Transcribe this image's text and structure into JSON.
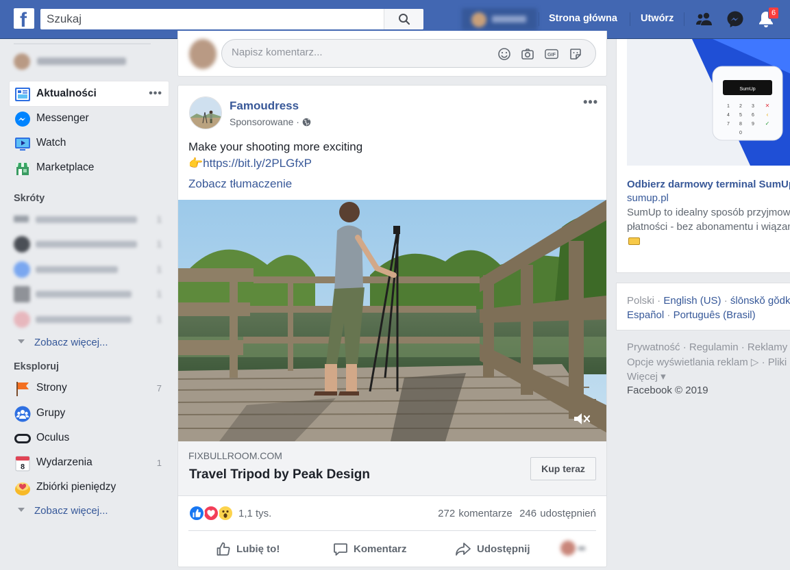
{
  "topbar": {
    "search_placeholder": "Szukaj",
    "profile_name": "Marek",
    "nav_home": "Strona główna",
    "nav_create": "Utwórz",
    "notifications_count": "6"
  },
  "sidebar": {
    "profile_name": "Marek Dombrowski",
    "main_items": [
      {
        "label": "Aktualności",
        "icon": "news-feed-icon",
        "more": "•••"
      },
      {
        "label": "Messenger",
        "icon": "messenger-icon"
      },
      {
        "label": "Watch",
        "icon": "watch-icon"
      },
      {
        "label": "Marketplace",
        "icon": "marketplace-icon"
      }
    ],
    "shortcuts_title": "Skróty",
    "shortcuts": [
      {
        "label": "Peak Design Polska",
        "count": "1"
      },
      {
        "label": "Il Leggero Thing Pro",
        "count": "1"
      },
      {
        "label": "Peak Design Vest",
        "count": "1"
      },
      {
        "label": "FUJIKAMARA - E",
        "count": "1"
      },
      {
        "label": "Interiorcanl Djales",
        "count": "1"
      }
    ],
    "see_more_1": "Zobacz więcej...",
    "explore_title": "Eksploruj",
    "explore": [
      {
        "label": "Strony",
        "icon": "flag-icon",
        "count": "7"
      },
      {
        "label": "Grupy",
        "icon": "groups-icon",
        "count": ""
      },
      {
        "label": "Oculus",
        "icon": "oculus-icon",
        "count": ""
      },
      {
        "label": "Wydarzenia",
        "icon": "calendar-icon",
        "count": "1",
        "calendar_day": "8"
      },
      {
        "label": "Zbiórki pieniędzy",
        "icon": "fundraiser-icon",
        "count": ""
      }
    ],
    "see_more_2": "Zobacz więcej..."
  },
  "comment": {
    "placeholder": "Napisz komentarz..."
  },
  "post": {
    "author": "Famoudress",
    "meta": "Sponsorowane · ",
    "text": "Make your shooting more exciting",
    "link_emoji": "👉",
    "link": "https://bit.ly/2PLGfxP",
    "translate": "Zobacz tłumaczenie",
    "link_domain": "FIXBULLROOM.COM",
    "link_title": "Travel Tripod by Peak Design",
    "cta": "Kup teraz",
    "reactions_count": "1,1 tys.",
    "comments": "272 komentarze",
    "shares": "246 udostępnień",
    "like_label": "Lubię to!",
    "comment_label": "Komentarz",
    "share_label": "Udostępnij"
  },
  "ad": {
    "title": "Odbierz darmowy terminal SumUp",
    "domain": "sumup.pl",
    "desc_line1": "SumUp to idealny sposób przyjmowania",
    "desc_line2": "płatności - bez abonamentu i wiązania",
    "terminal_label": "SumUp"
  },
  "languages": {
    "current": "Polski",
    "sep": " · ",
    "l1": "English (US)",
    "l2": "ślōnskŏ gŏdka",
    "l3": "Español",
    "l4": "Português (Brasil)"
  },
  "footer": {
    "line1": "Prywatność · Regulamin · Reklamy ·",
    "line2": "Opcje wyświetlania reklam ▷ · Pliki cookie",
    "line3": "Więcej ▾",
    "copyright": "Facebook © 2019"
  },
  "colors": {
    "brand_blue": "#4267b2",
    "link_blue": "#385898",
    "page_bg": "#e9ebee"
  }
}
